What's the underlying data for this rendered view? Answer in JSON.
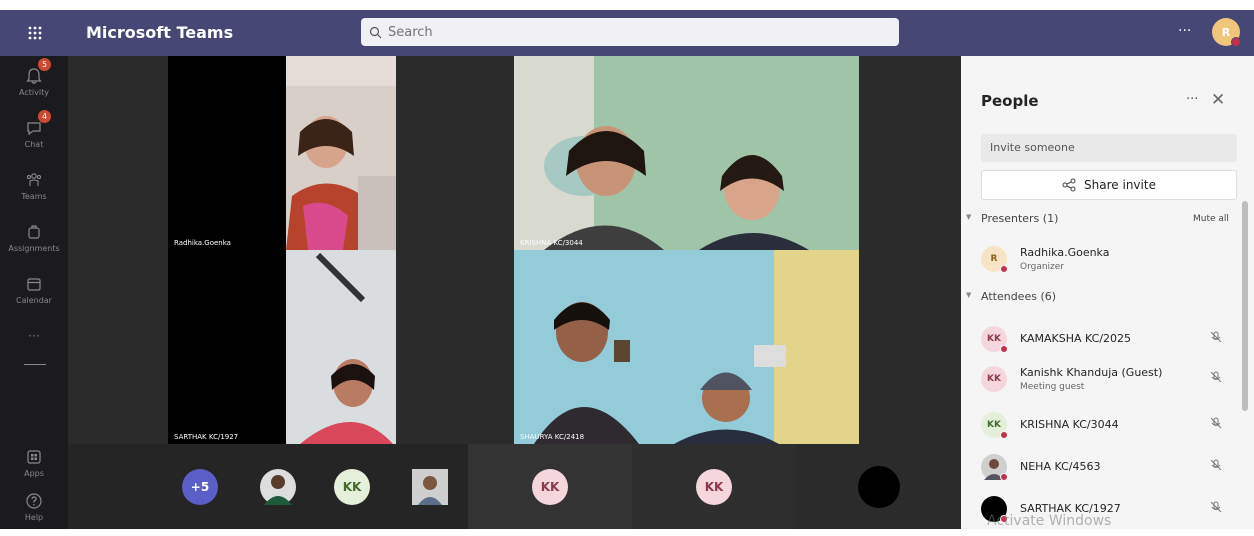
{
  "app": {
    "title": "Microsoft Teams",
    "search_placeholder": "Search",
    "more_label": "···",
    "user_initial": "R"
  },
  "rail": {
    "items": [
      {
        "label": "Activity",
        "badge": "5"
      },
      {
        "label": "Chat",
        "badge": "4"
      },
      {
        "label": "Teams"
      },
      {
        "label": "Assignments"
      },
      {
        "label": "Calendar"
      },
      {
        "label": "Apps"
      },
      {
        "label": "Help"
      }
    ],
    "more_label": "···"
  },
  "stage": {
    "tiles": [
      {
        "label": "Radhika.Goenka"
      },
      {
        "label": "KRISHNA KC/3044"
      },
      {
        "label": "SARTHAK KC/1927"
      },
      {
        "label": "SHAURYA KC/2418"
      }
    ]
  },
  "strip": {
    "overflow_count": "+5",
    "initials": [
      "KK",
      "KK",
      "KK"
    ]
  },
  "panel": {
    "title": "People",
    "more_label": "···",
    "close_label": "✕",
    "invite_placeholder": "Invite someone",
    "share_invite_label": "Share invite",
    "presenters_label": "Presenters (1)",
    "mute_all_label": "Mute all",
    "attendees_label": "Attendees (6)",
    "presenters": [
      {
        "name": "Radhika.Goenka",
        "role": "Organizer",
        "initials": "R"
      }
    ],
    "attendees": [
      {
        "name": "KAMAKSHA KC/2025",
        "initials": "KK"
      },
      {
        "name": "Kanishk Khanduja (Guest)",
        "role": "Meeting guest",
        "initials": "KK"
      },
      {
        "name": "KRISHNA KC/3044",
        "initials": "KK"
      },
      {
        "name": "NEHA KC/4563"
      },
      {
        "name": "SARTHAK KC/1927"
      }
    ]
  },
  "watermark": "Activate Windows"
}
